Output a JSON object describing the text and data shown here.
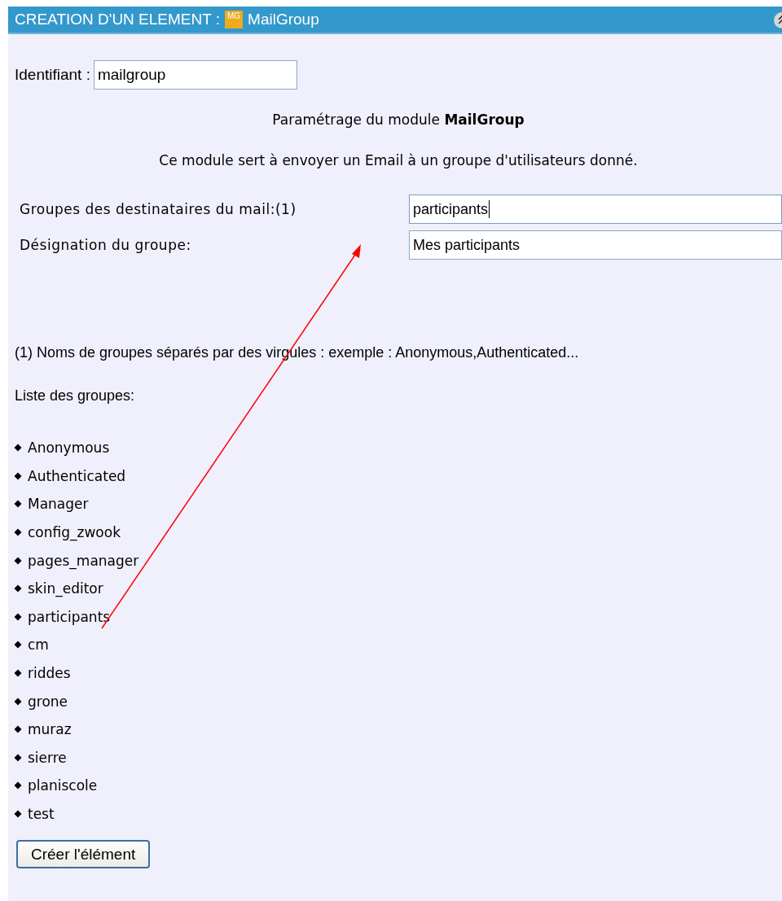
{
  "header": {
    "title": "CREATION D'UN ELEMENT :",
    "icon_text": "MG",
    "module": "MailGroup"
  },
  "identifier": {
    "label": "Identifiant :",
    "value": "mailgroup"
  },
  "heading": "Paramétrage du module **MailGroup**",
  "description": "Ce module sert à envoyer un Email à un groupe d'utilisateurs donné.",
  "fields": [
    {
      "label": "Groupes des destinataires du mail:(1)",
      "value": "participants",
      "focused": true
    },
    {
      "label": "Désignation du groupe:",
      "value": "Mes participants",
      "focused": false
    }
  ],
  "footnote": "(1) Noms de groupes séparés par des virgules : exemple : Anonymous,Authenticated...",
  "groups_title": "Liste des groupes:",
  "groups": [
    "Anonymous",
    "Authenticated",
    "Manager",
    "config_zwook",
    "pages_manager",
    "skin_editor",
    "participants",
    "cm",
    "riddes",
    "grone",
    "muraz",
    "sierre",
    "planiscole",
    "test"
  ],
  "submit": "Créer l'élément"
}
